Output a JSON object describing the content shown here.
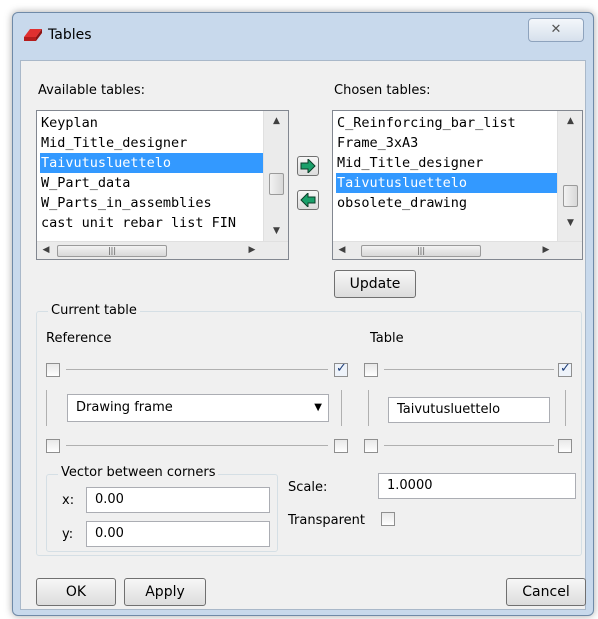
{
  "window": {
    "title": "Tables",
    "close_glyph": "✕"
  },
  "available": {
    "label": "Available tables:",
    "items": [
      "Keyplan",
      "Mid_Title_designer",
      "Taivutusluettelo",
      "W_Part_data",
      "W_Parts_in_assemblies",
      "cast unit rebar list FIN"
    ],
    "selected_index": 2
  },
  "chosen": {
    "label": "Chosen tables:",
    "items": [
      "C_Reinforcing_bar_list",
      "Frame_3xA3",
      "Mid_Title_designer",
      "Taivutusluettelo",
      "obsolete_drawing"
    ],
    "selected_index": 3
  },
  "transfer": {
    "add_icon": "arrow-right-icon",
    "remove_icon": "arrow-left-icon"
  },
  "update_label": "Update",
  "current_table": {
    "group_label": "Current table",
    "reference_label": "Reference",
    "table_label": "Table",
    "reference_value": "Drawing frame",
    "table_value": "Taivutusluettelo",
    "ref_top_left_checked": false,
    "ref_top_right_checked": true,
    "tbl_top_left_checked": false,
    "tbl_top_right_checked": true
  },
  "vector": {
    "group_label": "Vector between corners",
    "x_label": "x:",
    "x_value": "0.00",
    "y_label": "y:",
    "y_value": "0.00"
  },
  "scale": {
    "label": "Scale:",
    "value": "1.0000"
  },
  "transparent": {
    "label": "Transparent",
    "checked": false
  },
  "buttons": {
    "ok": "OK",
    "apply": "Apply",
    "cancel": "Cancel"
  },
  "colors": {
    "selection": "#3399ff",
    "arrow": "#1aa06a"
  }
}
